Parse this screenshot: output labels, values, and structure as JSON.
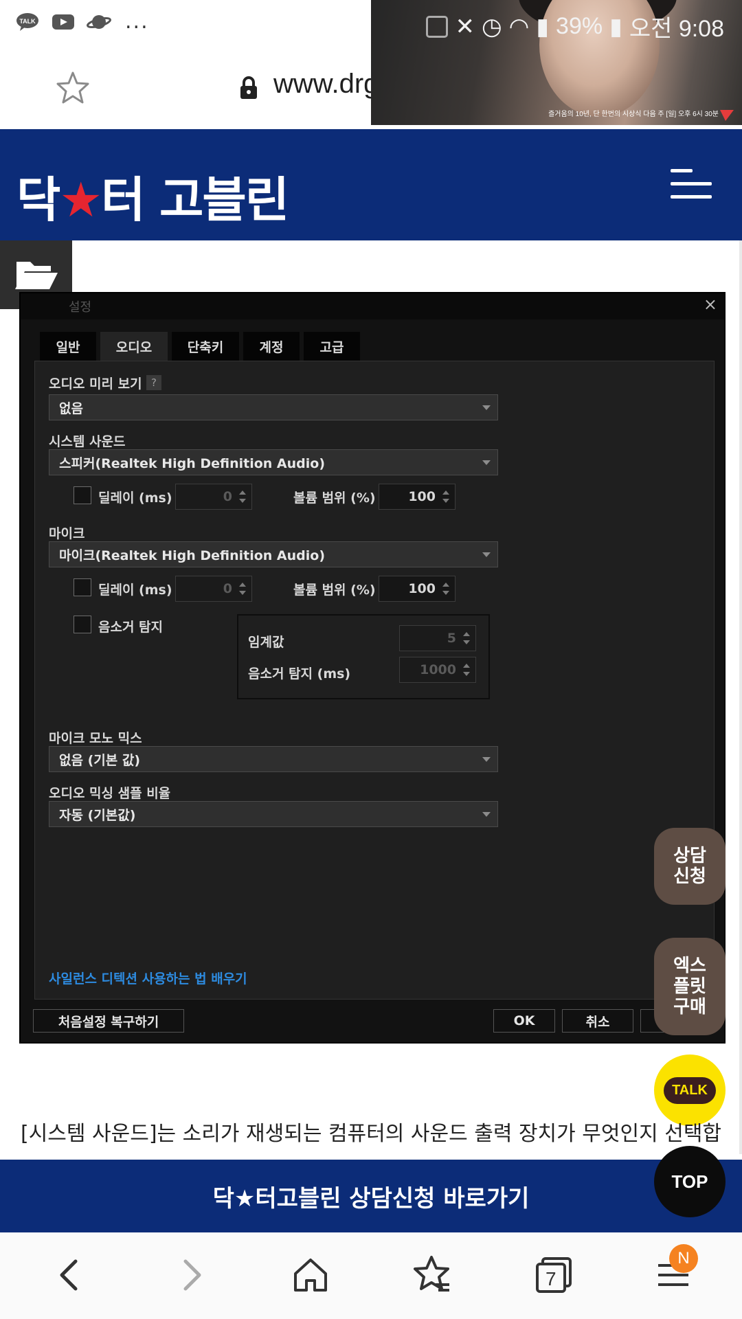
{
  "status_bar": {
    "dots": "...",
    "battery": "39%",
    "time": "오전 9:08"
  },
  "browser": {
    "url": "www.drg"
  },
  "pip_video": {
    "caption": "즐거움의 10년, 단 한번의 시상식 다음 주 [일] 오후 6시 30분"
  },
  "site": {
    "logo_left": "닥",
    "logo_star": "★",
    "logo_right": "터 고블린"
  },
  "dialog": {
    "title": "설정",
    "close": "×",
    "tabs": [
      "일반",
      "오디오",
      "단축키",
      "계정",
      "고급"
    ],
    "active_tab": "오디오",
    "audio_preview_label": "오디오 미리 보기",
    "help": "?",
    "audio_preview_value": "없음",
    "system_sound_label": "시스템 사운드",
    "system_sound_value": "스피커(Realtek High Definition Audio)",
    "delay_label": "딜레이 (ms)",
    "delay_value": "0",
    "volume_label": "볼륨 범위 (%)",
    "volume_value": "100",
    "mic_label": "마이크",
    "mic_value": "마이크(Realtek High Definition Audio)",
    "mic_delay_label": "딜레이 (ms)",
    "mic_delay_value": "0",
    "mic_volume_label": "볼륨 범위 (%)",
    "mic_volume_value": "100",
    "noise_detect_label": "음소거 탐지",
    "threshold_label": "임계값",
    "threshold_value": "5",
    "noise_ms_label": "음소거 탐지 (ms)",
    "noise_ms_value": "1000",
    "mono_mix_label": "마이크 모노 믹스",
    "mono_mix_value": "없음 (기본 값)",
    "sample_rate_label": "오디오 믹싱 샘플 비율",
    "sample_rate_value": "자동 (기본값)",
    "learn_link": "사일런스 디텍션 사용하는 법 배우기",
    "reset_button": "처음설정 복구하기",
    "ok_button": "OK",
    "cancel_button": "취소"
  },
  "floating": {
    "consult": "상담\n신청",
    "exploit": "엑스\n플릿\n구매",
    "talk": "TALK",
    "top": "TOP"
  },
  "article": {
    "text": "[시스템 사운드]는 소리가 재생되는 컴퓨터의 사운드 출력 장치가 무엇인지 선택합"
  },
  "banner": {
    "text": "닥★터고블린 상담신청 바로가기"
  },
  "nav": {
    "tabs_count": "7",
    "badge": "N"
  },
  "colors": {
    "brand_navy": "#0c2c78",
    "logo_star_red": "#e52530",
    "float_brown": "#5e4d44",
    "kakao_yellow": "#fbe200",
    "badge_orange": "#f58220",
    "link_blue": "#2d8be0"
  }
}
